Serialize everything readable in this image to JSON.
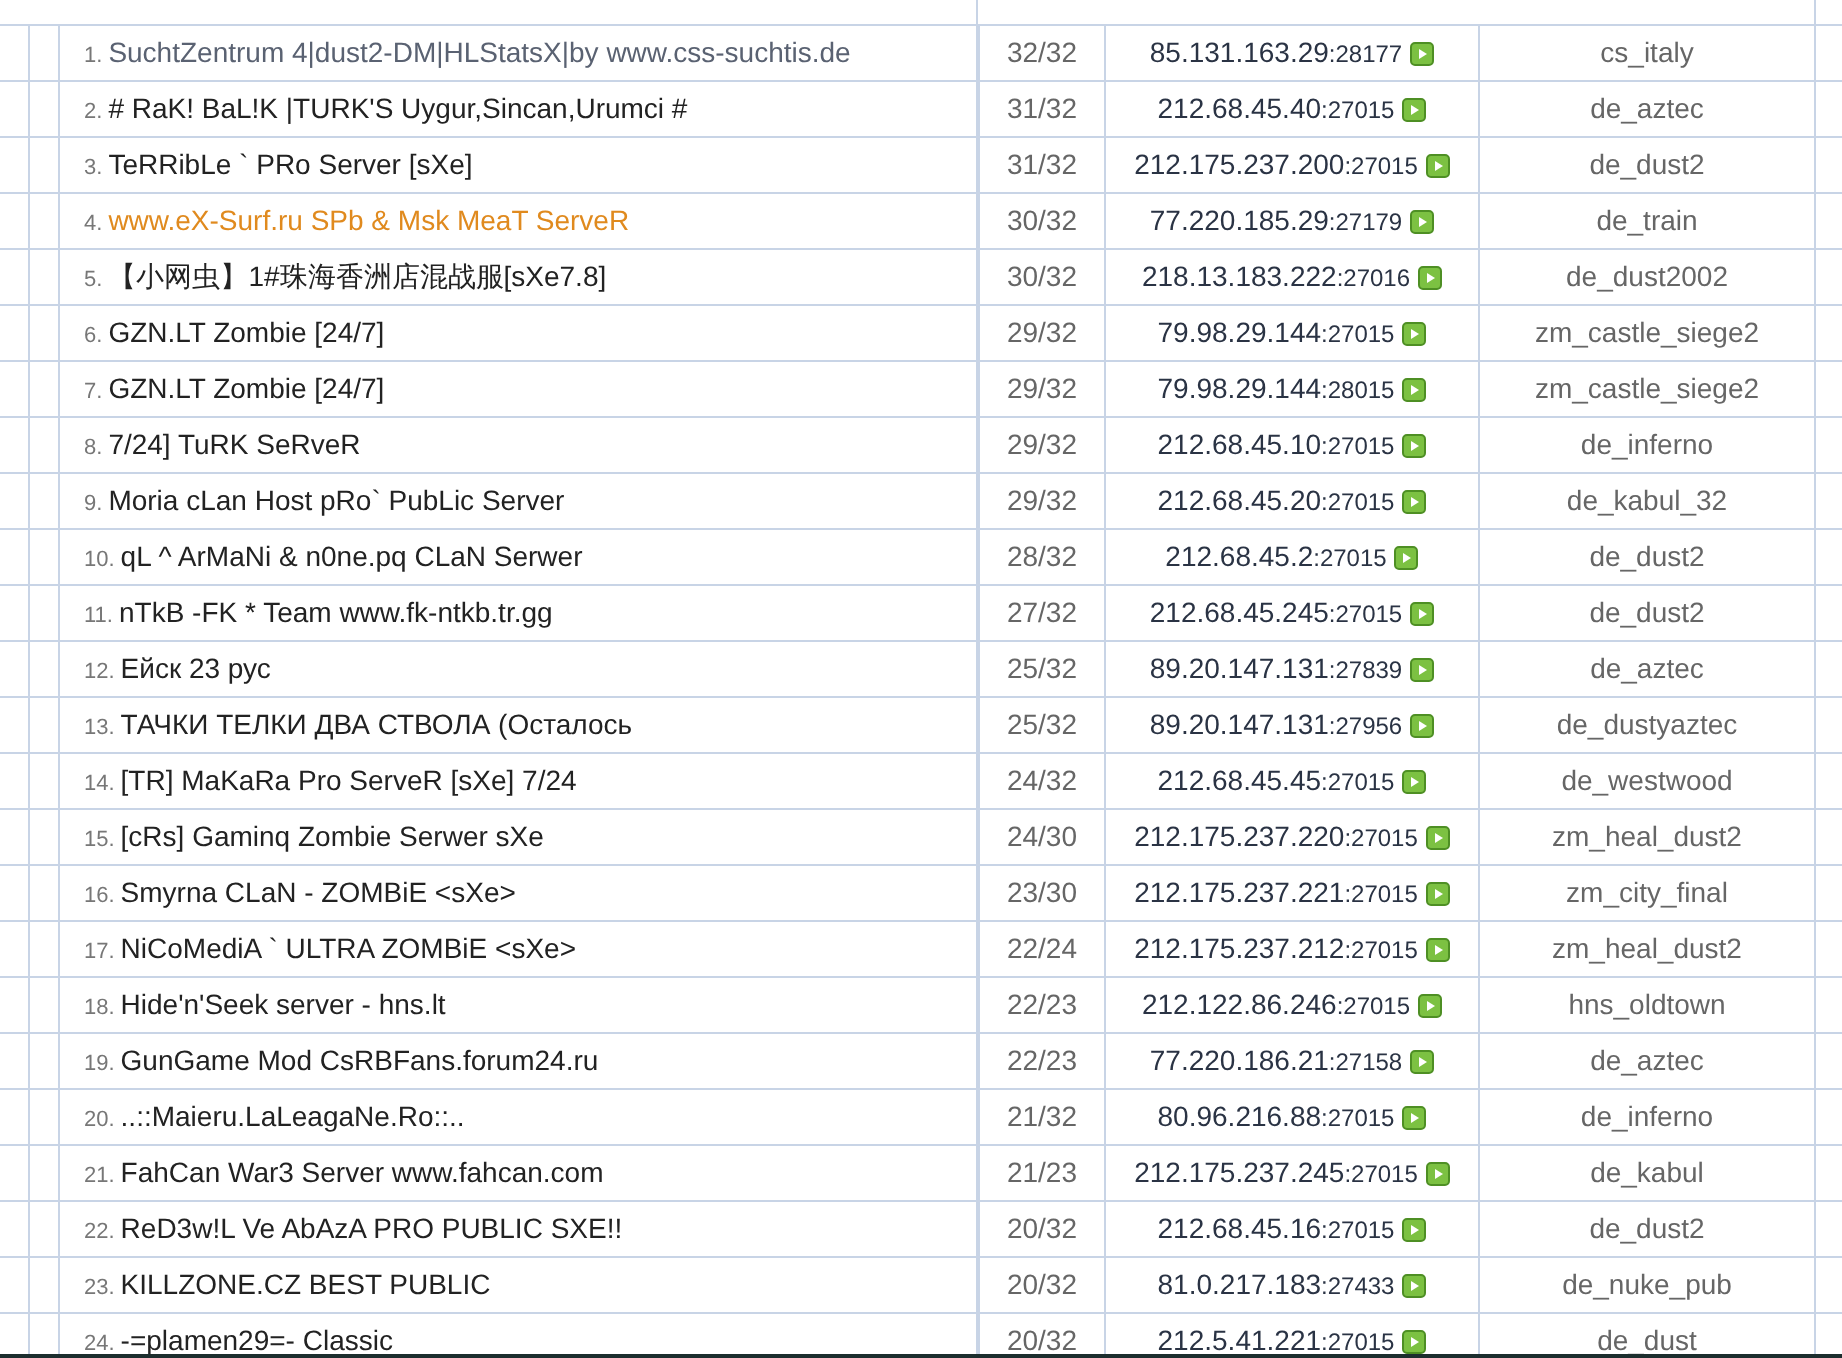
{
  "servers": [
    {
      "rank": "1.",
      "name": "SuchtZentrum 4|dust2-DM|HLStatsX|by www.css-suchtis.de",
      "color": "#5a6272",
      "players": "32/32",
      "host": "85.131.163.29",
      "port": ":28177",
      "map": "cs_italy"
    },
    {
      "rank": "2.",
      "name": "# RaK! BaL!K |TURK'S Uygur,Sincan,Urumci #",
      "color": "#222222",
      "players": "31/32",
      "host": "212.68.45.40",
      "port": ":27015",
      "map": "de_aztec"
    },
    {
      "rank": "3.",
      "name": "TeRRibLe ` PRo Server [sXe]",
      "color": "#222222",
      "players": "31/32",
      "host": "212.175.237.200",
      "port": ":27015",
      "map": "de_dust2"
    },
    {
      "rank": "4.",
      "name": "www.eX-Surf.ru SPb & Msk MeaT ServeR",
      "color": "#e08a1e",
      "players": "30/32",
      "host": "77.220.185.29",
      "port": ":27179",
      "map": "de_train"
    },
    {
      "rank": "5.",
      "name": "【小网虫】1#珠海香洲店混战服[sXe7.8]",
      "color": "#222222",
      "players": "30/32",
      "host": "218.13.183.222",
      "port": ":27016",
      "map": "de_dust2002"
    },
    {
      "rank": "6.",
      "name": "GZN.LT Zombie [24/7]",
      "color": "#222222",
      "players": "29/32",
      "host": "79.98.29.144",
      "port": ":27015",
      "map": "zm_castle_siege2"
    },
    {
      "rank": "7.",
      "name": "GZN.LT Zombie [24/7]",
      "color": "#222222",
      "players": "29/32",
      "host": "79.98.29.144",
      "port": ":28015",
      "map": "zm_castle_siege2"
    },
    {
      "rank": "8.",
      "name": "7/24] TuRK SeRveR",
      "color": "#222222",
      "players": "29/32",
      "host": "212.68.45.10",
      "port": ":27015",
      "map": "de_inferno"
    },
    {
      "rank": "9.",
      "name": "Moria cLan Host pRo` PubLic Server",
      "color": "#222222",
      "players": "29/32",
      "host": "212.68.45.20",
      "port": ":27015",
      "map": "de_kabul_32"
    },
    {
      "rank": "10.",
      "name": "qL ^ ArMaNi & n0ne.pq CLaN Serwer",
      "color": "#222222",
      "players": "28/32",
      "host": "212.68.45.2",
      "port": ":27015",
      "map": "de_dust2"
    },
    {
      "rank": "11.",
      "name": "nTkB -FK * Team www.fk-ntkb.tr.gg",
      "color": "#222222",
      "players": "27/32",
      "host": "212.68.45.245",
      "port": ":27015",
      "map": "de_dust2"
    },
    {
      "rank": "12.",
      "name": "Ейск 23 рус",
      "color": "#222222",
      "players": "25/32",
      "host": "89.20.147.131",
      "port": ":27839",
      "map": "de_aztec"
    },
    {
      "rank": "13.",
      "name": "ТАЧКИ ТЕЛКИ ДВА СТВОЛА (Осталось",
      "color": "#222222",
      "players": "25/32",
      "host": "89.20.147.131",
      "port": ":27956",
      "map": "de_dustyaztec"
    },
    {
      "rank": "14.",
      "name": "[TR] MaKaRa Pro ServeR [sXe] 7/24",
      "color": "#222222",
      "players": "24/32",
      "host": "212.68.45.45",
      "port": ":27015",
      "map": "de_westwood"
    },
    {
      "rank": "15.",
      "name": "[cRs] Gaminq Zombie Serwer sXe",
      "color": "#222222",
      "players": "24/30",
      "host": "212.175.237.220",
      "port": ":27015",
      "map": "zm_heal_dust2"
    },
    {
      "rank": "16.",
      "name": "Smyrna CLaN - ZOMBiE <sXe>",
      "color": "#222222",
      "players": "23/30",
      "host": "212.175.237.221",
      "port": ":27015",
      "map": "zm_city_final"
    },
    {
      "rank": "17.",
      "name": "NiCoMediA ` ULTRA ZOMBiE <sXe>",
      "color": "#222222",
      "players": "22/24",
      "host": "212.175.237.212",
      "port": ":27015",
      "map": "zm_heal_dust2"
    },
    {
      "rank": "18.",
      "name": "Hide'n'Seek server - hns.lt",
      "color": "#222222",
      "players": "22/23",
      "host": "212.122.86.246",
      "port": ":27015",
      "map": "hns_oldtown"
    },
    {
      "rank": "19.",
      "name": "GunGame Mod CsRBFans.forum24.ru",
      "color": "#222222",
      "players": "22/23",
      "host": "77.220.186.21",
      "port": ":27158",
      "map": "de_aztec"
    },
    {
      "rank": "20.",
      "name": "..::Maieru.LaLeagaNe.Ro::..",
      "color": "#222222",
      "players": "21/32",
      "host": "80.96.216.88",
      "port": ":27015",
      "map": "de_inferno"
    },
    {
      "rank": "21.",
      "name": "FahCan War3 Server www.fahcan.com",
      "color": "#222222",
      "players": "21/23",
      "host": "212.175.237.245",
      "port": ":27015",
      "map": "de_kabul"
    },
    {
      "rank": "22.",
      "name": "ReD3w!L Ve AbAzA PRO PUBLIC SXE!!",
      "color": "#222222",
      "players": "20/32",
      "host": "212.68.45.16",
      "port": ":27015",
      "map": "de_dust2"
    },
    {
      "rank": "23.",
      "name": "KILLZONE.CZ BEST PUBLIC",
      "color": "#222222",
      "players": "20/32",
      "host": "81.0.217.183",
      "port": ":27433",
      "map": "de_nuke_pub"
    },
    {
      "rank": "24.",
      "name": "-=plamen29=- Classic",
      "color": "#222222",
      "players": "20/32",
      "host": "212.5.41.221",
      "port": ":27015",
      "map": "de_dust"
    }
  ]
}
